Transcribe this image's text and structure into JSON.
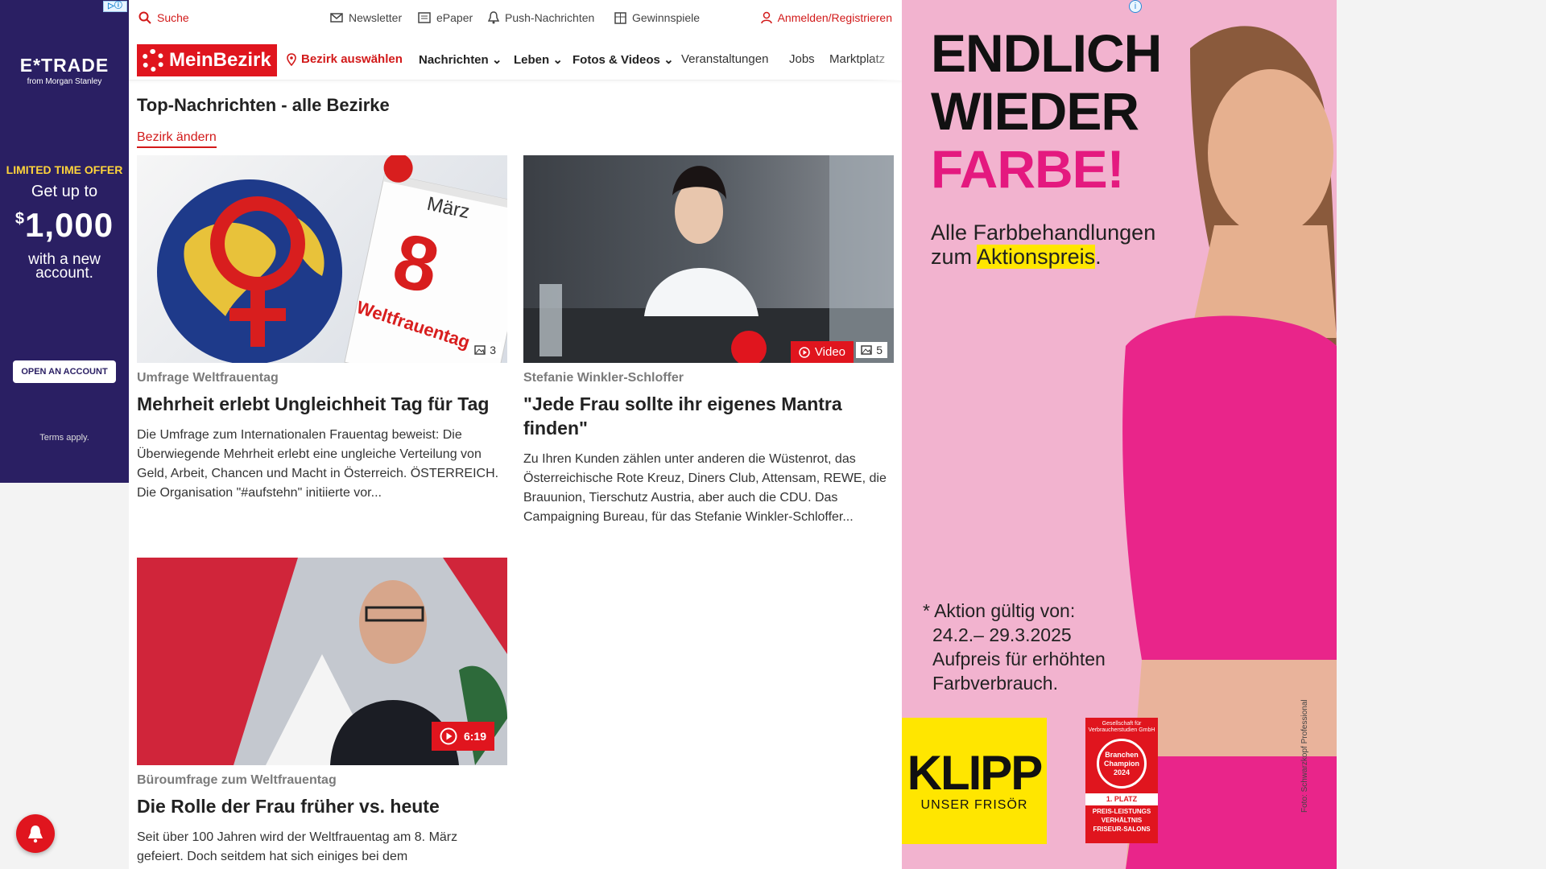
{
  "ad_left": {
    "adchoice": "▷ⓘ",
    "brand": "E*TRADE",
    "brand_sub": "from Morgan Stanley",
    "offer": "LIMITED TIME OFFER",
    "get_up_to": "Get up to",
    "currency": "$",
    "amount": "1,000",
    "with_new": "with a new account.",
    "cta": "OPEN AN ACCOUNT",
    "terms": "Terms apply."
  },
  "topbar": {
    "search": "Suche",
    "newsletter": "Newsletter",
    "epaper": "ePaper",
    "push": "Push-Nachrichten",
    "gewinnspiele": "Gewinnspiele",
    "login": "Anmelden/Registrieren"
  },
  "nav": {
    "logo": "MeinBezirk",
    "bezirk": "Bezirk auswählen",
    "items": [
      "Nachrichten",
      "Leben",
      "Fotos & Videos",
      "Veranstaltungen",
      "Jobs",
      "Marktplatz"
    ]
  },
  "page": {
    "title": "Top-Nachrichten - alle Bezirke",
    "change_district": "Bezirk ändern"
  },
  "articles": [
    {
      "kicker": "Umfrage Weltfrauentag",
      "headline": "Mehrheit erlebt Ungleichheit Tag für Tag",
      "teaser": "Die Umfrage zum Internationalen Frauentag beweist: Die Überwiegende Mehrheit erlebt eine ungleiche Verteilung von Geld, Arbeit, Chancen und Macht in Österreich. ÖSTERREICH. Die Organisation \"#aufstehn\" initiierte vor...",
      "image_count": "3",
      "calendar_month": "März",
      "calendar_day": "8",
      "calendar_label": "Weltfrauentag"
    },
    {
      "kicker": "Stefanie Winkler-Schloffer",
      "headline": "\"Jede Frau sollte ihr eigenes Mantra finden\"",
      "teaser": "Zu Ihren Kunden zählen unter anderen die Wüstenrot, das Österreichische Rote Kreuz, Diners Club, Attensam, REWE, die Brauunion, Tierschutz Austria, aber auch die CDU. Das Campaigning Bureau, für das Stefanie Winkler-Schloffer...",
      "video_label": "Video",
      "image_count": "5"
    },
    {
      "kicker": "Büroumfrage zum Weltfrauentag",
      "headline": "Die Rolle der Frau früher vs. heute",
      "teaser": "Seit über 100 Jahren wird der Weltfrauentag am 8. März gefeiert. Doch seitdem hat sich einiges bei dem",
      "duration": "6:19"
    }
  ],
  "ad_right": {
    "line1": "ENDLICH",
    "line2": "WIEDER",
    "line3": "FARBE!",
    "sub1": "Alle Farbbehandlungen",
    "sub2": "zum",
    "sub_highlight": "Aktionspreis",
    "sub_end": ".",
    "note1": "* Aktion gültig von:",
    "note2": "24.2.– 29.3.2025",
    "note3": "Aufpreis für erhöhten",
    "note4": "Farbverbrauch.",
    "klipp": "KLIPP",
    "klipp_sub": "UNSER FRISÖR",
    "award_top": "Gesellschaft für Verbraucherstudien GmbH",
    "award_ring": "Branchen Champion 2024",
    "award_place": "1. PLATZ",
    "award_text": "PREIS-LEISTUNGS VERHÄLTNIS FRISEUR-SALONS",
    "photo_credit": "Foto: Schwarzkopf Professional"
  },
  "colors": {
    "brand_red": "#e0151e",
    "ad_purple": "#2a1f63",
    "ad_pink": "#f2b3cf",
    "highlight_yellow": "#ffe600"
  }
}
